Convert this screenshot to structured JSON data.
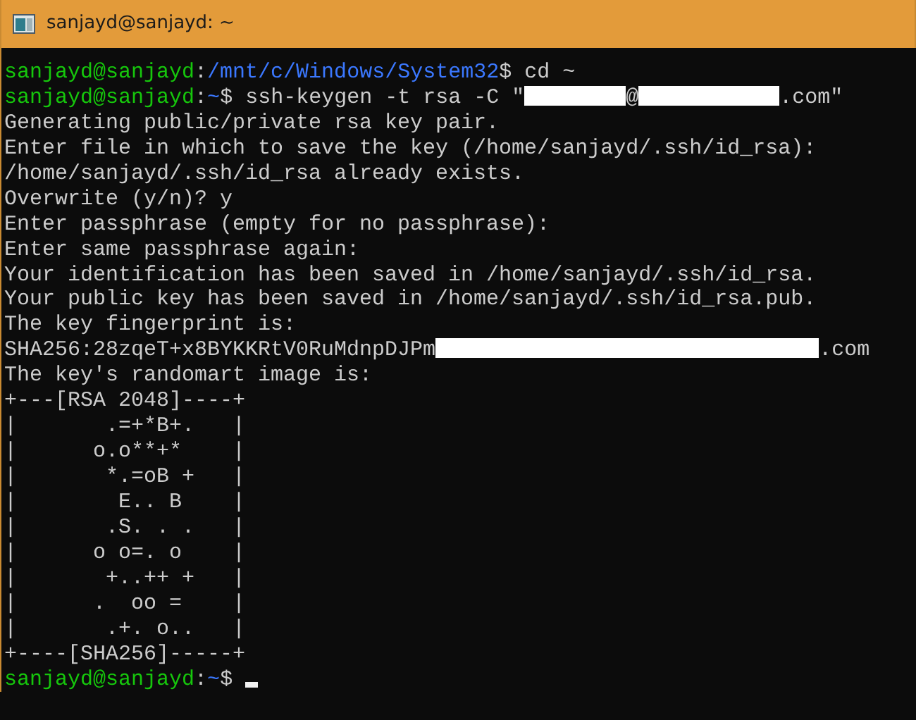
{
  "window": {
    "title": "sanjayd@sanjayd: ~"
  },
  "lines": [
    {
      "segments": [
        {
          "kind": "user",
          "text": "sanjayd@sanjayd"
        },
        {
          "kind": "text",
          "text": ":"
        },
        {
          "kind": "path",
          "text": "/mnt/c/Windows/System32"
        },
        {
          "kind": "text",
          "text": "$ cd ~"
        }
      ]
    },
    {
      "segments": [
        {
          "kind": "user",
          "text": "sanjayd@sanjayd"
        },
        {
          "kind": "text",
          "text": ":"
        },
        {
          "kind": "path",
          "text": "~"
        },
        {
          "kind": "text",
          "text": "$ ssh-keygen -t rsa -C \""
        },
        {
          "kind": "redaction_short"
        },
        {
          "kind": "text",
          "text": "@"
        },
        {
          "kind": "redaction_medium"
        },
        {
          "kind": "text",
          "text": ".com\""
        }
      ]
    },
    {
      "segments": [
        {
          "kind": "text",
          "text": "Generating public/private rsa key pair."
        }
      ]
    },
    {
      "segments": [
        {
          "kind": "text",
          "text": "Enter file in which to save the key (/home/sanjayd/.ssh/id_rsa):"
        }
      ]
    },
    {
      "segments": [
        {
          "kind": "text",
          "text": "/home/sanjayd/.ssh/id_rsa already exists."
        }
      ]
    },
    {
      "segments": [
        {
          "kind": "text",
          "text": "Overwrite (y/n)? y"
        }
      ]
    },
    {
      "segments": [
        {
          "kind": "text",
          "text": "Enter passphrase (empty for no passphrase):"
        }
      ]
    },
    {
      "segments": [
        {
          "kind": "text",
          "text": "Enter same passphrase again:"
        }
      ]
    },
    {
      "segments": [
        {
          "kind": "text",
          "text": "Your identification has been saved in /home/sanjayd/.ssh/id_rsa."
        }
      ]
    },
    {
      "segments": [
        {
          "kind": "text",
          "text": "Your public key has been saved in /home/sanjayd/.ssh/id_rsa.pub."
        }
      ]
    },
    {
      "segments": [
        {
          "kind": "text",
          "text": "The key fingerprint is:"
        }
      ]
    },
    {
      "segments": [
        {
          "kind": "text",
          "text": "SHA256:28zqeT+x8BYKKRtV0RuMdnpDJPm"
        },
        {
          "kind": "redaction_long"
        },
        {
          "kind": "text",
          "text": ".com"
        }
      ]
    },
    {
      "segments": [
        {
          "kind": "text",
          "text": "The key's randomart image is:"
        }
      ]
    },
    {
      "segments": [
        {
          "kind": "text",
          "text": "+---[RSA 2048]----+"
        }
      ]
    },
    {
      "segments": [
        {
          "kind": "text",
          "text": "|       .=+*B+.   |"
        }
      ]
    },
    {
      "segments": [
        {
          "kind": "text",
          "text": "|      o.o**+*    |"
        }
      ]
    },
    {
      "segments": [
        {
          "kind": "text",
          "text": "|       *.=oB +   |"
        }
      ]
    },
    {
      "segments": [
        {
          "kind": "text",
          "text": "|        E.. B    |"
        }
      ]
    },
    {
      "segments": [
        {
          "kind": "text",
          "text": "|       .S. . .   |"
        }
      ]
    },
    {
      "segments": [
        {
          "kind": "text",
          "text": "|      o o=. o    |"
        }
      ]
    },
    {
      "segments": [
        {
          "kind": "text",
          "text": "|       +..++ +   |"
        }
      ]
    },
    {
      "segments": [
        {
          "kind": "text",
          "text": "|      .  oo =    |"
        }
      ]
    },
    {
      "segments": [
        {
          "kind": "text",
          "text": "|       .+. o..   |"
        }
      ]
    },
    {
      "segments": [
        {
          "kind": "text",
          "text": "+----[SHA256]-----+"
        }
      ]
    },
    {
      "segments": [
        {
          "kind": "user",
          "text": "sanjayd@sanjayd"
        },
        {
          "kind": "text",
          "text": ":"
        },
        {
          "kind": "path",
          "text": "~"
        },
        {
          "kind": "text",
          "text": "$ "
        },
        {
          "kind": "cursor"
        }
      ]
    }
  ]
}
